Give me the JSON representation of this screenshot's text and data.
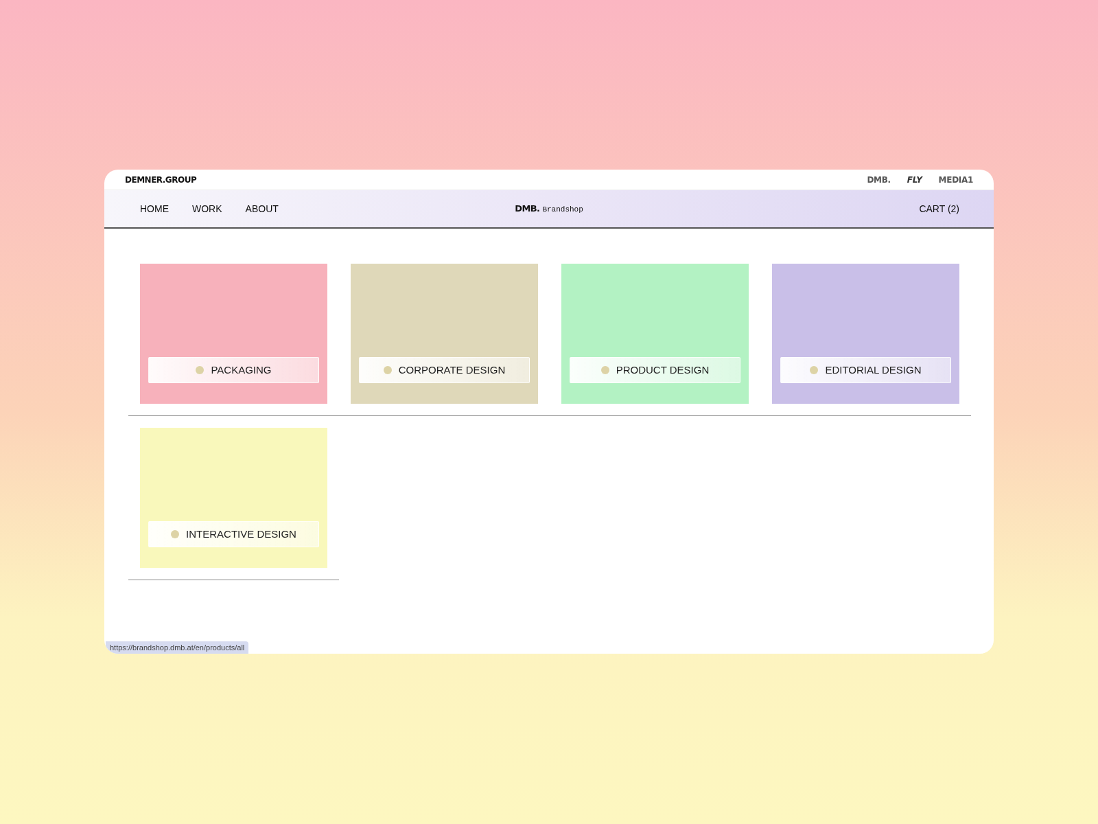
{
  "top_bar": {
    "brand": "DEMNER.GROUP",
    "links": [
      "DMB.",
      "FLY",
      "MEDIA1"
    ]
  },
  "nav": {
    "items": [
      "HOME",
      "WORK",
      "ABOUT"
    ],
    "logo": {
      "mark": "DMB.",
      "text": "Brandshop"
    },
    "cart": "CART (2)"
  },
  "categories": [
    {
      "label": "PACKAGING",
      "color": "#f7b1bb"
    },
    {
      "label": "CORPORATE DESIGN",
      "color": "#dfd8b9"
    },
    {
      "label": "PRODUCT DESIGN",
      "color": "#b3f2c3"
    },
    {
      "label": "EDITORIAL DESIGN",
      "color": "#c9bfe8"
    },
    {
      "label": "INTERACTIVE DESIGN",
      "color": "#f9f8bb"
    }
  ],
  "status_bar": {
    "url": "https://brandshop.dmb.at/en/products/all"
  }
}
